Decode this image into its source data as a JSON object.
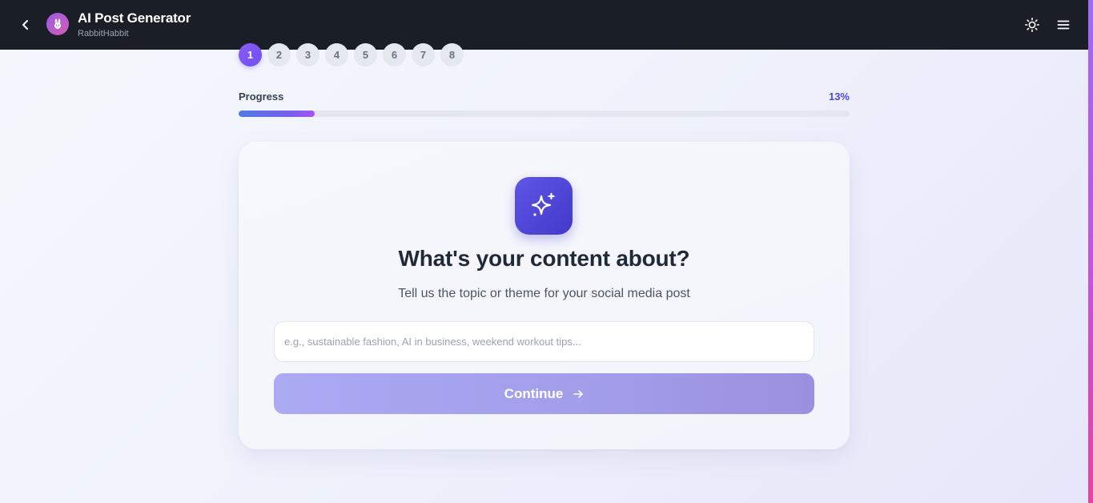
{
  "header": {
    "title": "AI Post Generator",
    "subtitle": "RabbitHabbit",
    "back_icon": "chevron-left-icon",
    "avatar_icon": "rabbit-icon",
    "theme_icon": "sun-icon",
    "menu_icon": "hamburger-menu-icon"
  },
  "steps": {
    "items": [
      "1",
      "2",
      "3",
      "4",
      "5",
      "6",
      "7",
      "8"
    ],
    "current": "1"
  },
  "progress": {
    "label": "Progress",
    "percent_text": "13%",
    "value_fraction": 0.125
  },
  "card": {
    "icon": "sparkles-icon",
    "title": "What's your content about?",
    "subtitle": "Tell us the topic or theme for your social media post",
    "input_placeholder": "e.g., sustainable fashion, AI in business, weekend workout tips...",
    "input_value": "",
    "continue_label": "Continue",
    "continue_icon": "arrow-right-icon"
  },
  "colors": {
    "header_bg": "#1a1f27",
    "accent": "#4f46e5",
    "active_step": "#7c5cf3",
    "button_bg": "#a7a5ee"
  }
}
